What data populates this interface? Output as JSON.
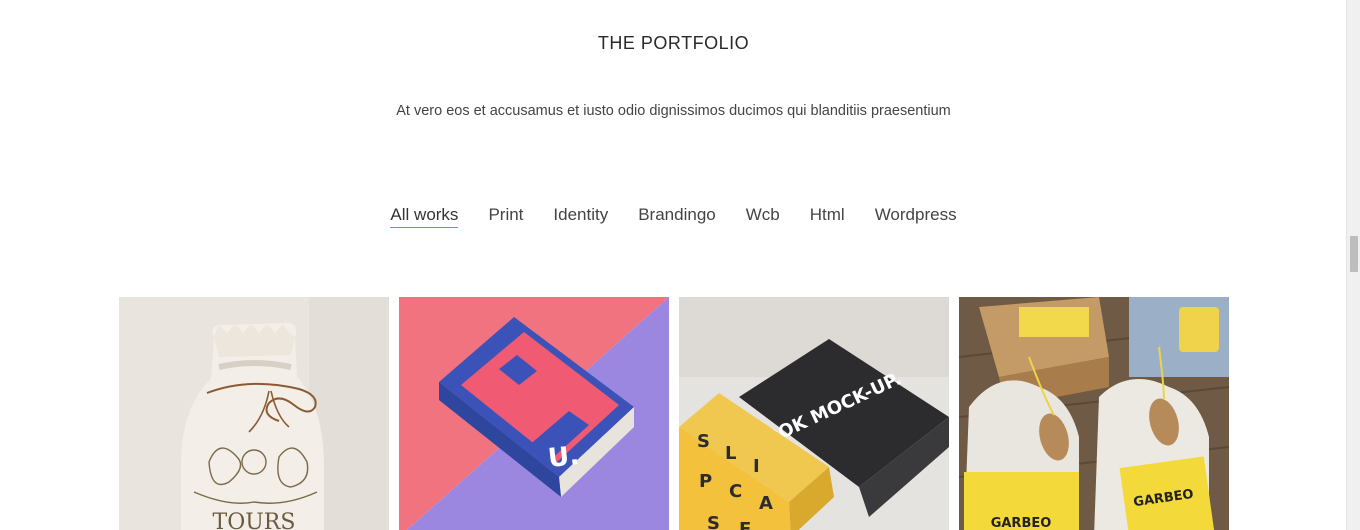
{
  "section": {
    "title": "THE PORTFOLIO",
    "subtitle": "At vero eos et accusamus et iusto odio dignissimos ducimos qui blanditiis praesentium"
  },
  "filters": {
    "active_index": 0,
    "items": [
      {
        "label": "All works"
      },
      {
        "label": "Print"
      },
      {
        "label": "Identity"
      },
      {
        "label": "Brandingo"
      },
      {
        "label": "Wcb"
      },
      {
        "label": "Html"
      },
      {
        "label": "Wordpress"
      }
    ],
    "accent_color": "#2bb7b0"
  },
  "portfolio": {
    "items": [
      {
        "name": "tours-bag",
        "image_text": "TOURS"
      },
      {
        "name": "book-mockup-pink",
        "image_text": "U."
      },
      {
        "name": "slipcase-book-mockup",
        "image_text": "BOOK MOCK-UP."
      },
      {
        "name": "garbeo-packaging",
        "image_text": "GARBEO"
      }
    ]
  }
}
